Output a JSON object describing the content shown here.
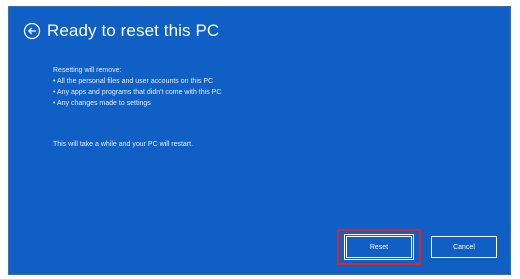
{
  "dialog": {
    "title": "Ready to reset this PC",
    "back_icon": "back-arrow-circle-icon",
    "body_lines": [
      "Resetting will remove:",
      "• All the personal files and user accounts on this PC",
      "• Any apps and programs that didn't come with this PC",
      "• Any changes made to settings"
    ],
    "note": "This will take a while and your PC will restart.",
    "buttons": {
      "reset_label": "Reset",
      "cancel_label": "Cancel"
    }
  },
  "colors": {
    "background": "#0f5fc4",
    "text": "#ffffff",
    "focus_highlight": "#d6242c"
  }
}
